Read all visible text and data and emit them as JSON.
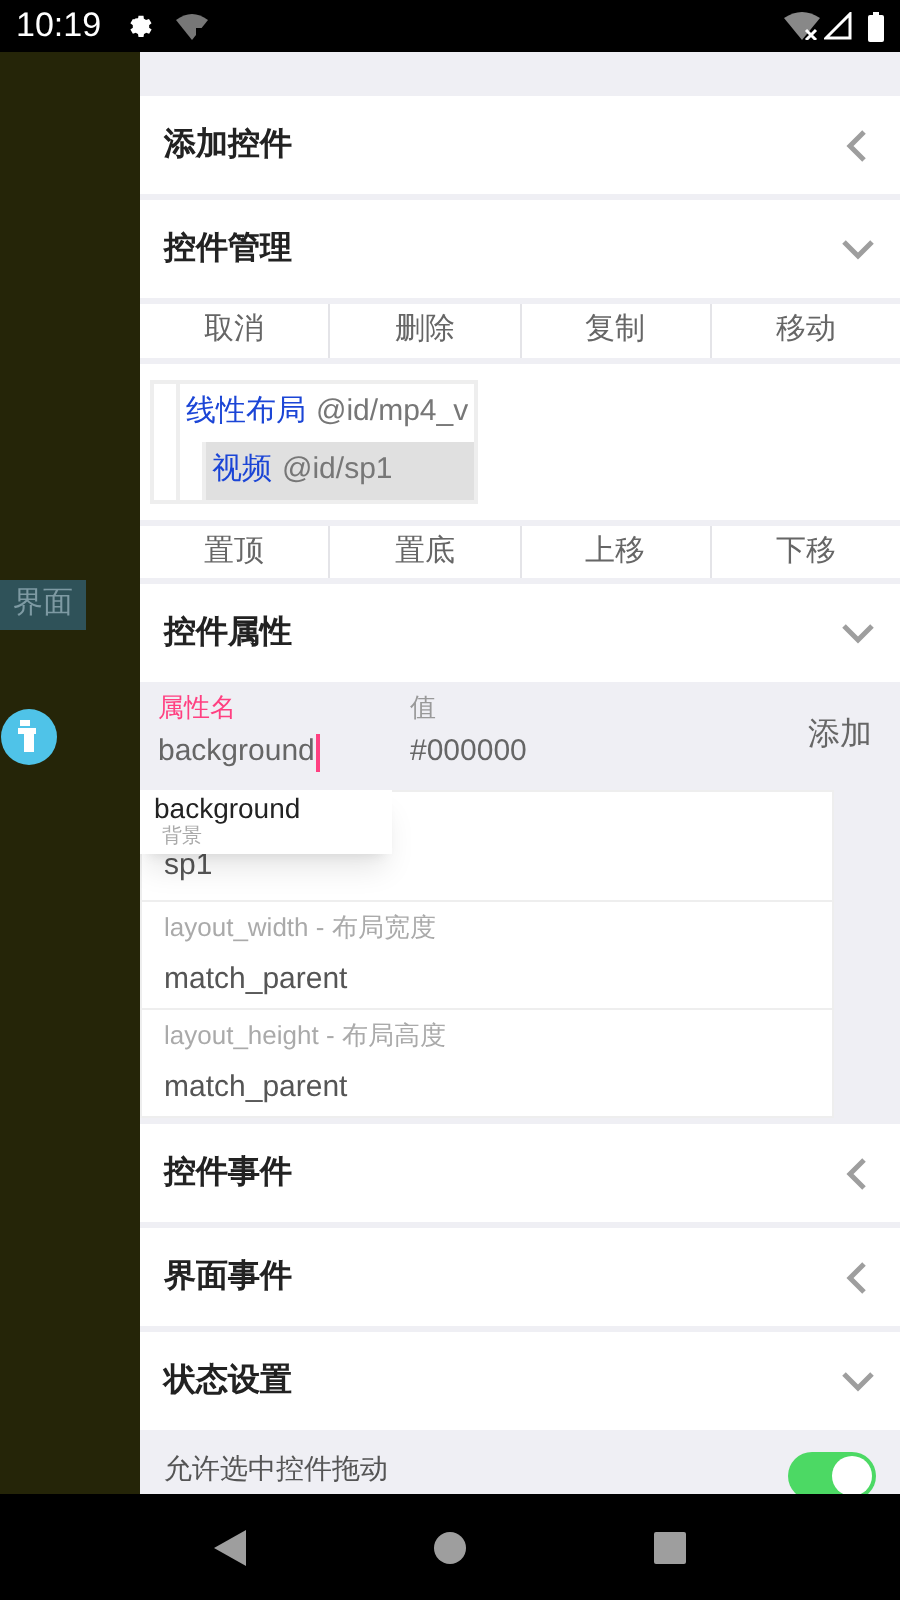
{
  "status_bar": {
    "time": "10:19"
  },
  "side_panel": {
    "tab": "界面"
  },
  "sections": [
    {
      "title": "添加控件",
      "expanded": false
    },
    {
      "title": "控件管理",
      "expanded": true,
      "actions_top": [
        "取消",
        "删除",
        "复制",
        "移动"
      ],
      "tree": [
        {
          "label": "线性布局",
          "id": "@id/mp4_v",
          "selected": false,
          "children": [
            {
              "label": "视频",
              "id": "@id/sp1",
              "selected": true
            }
          ]
        }
      ],
      "actions_bottom": [
        "置顶",
        "置底",
        "上移",
        "下移"
      ]
    },
    {
      "title": "控件属性",
      "expanded": true,
      "fields": [
        {
          "label": "属性名",
          "value": "background",
          "focused": true
        },
        {
          "label": "值",
          "value": "#000000",
          "focused": false
        }
      ],
      "add_button": "添加",
      "suggestion": {
        "name": "background",
        "hint": "背景"
      },
      "properties": [
        {
          "value": "sp1"
        },
        {
          "label": "layout_width - 布局宽度",
          "value": "match_parent"
        },
        {
          "label": "layout_height - 布局高度",
          "value": "match_parent"
        }
      ]
    },
    {
      "title": "控件事件",
      "expanded": false
    },
    {
      "title": "界面事件",
      "expanded": false
    },
    {
      "title": "状态设置",
      "expanded": true,
      "toggles": [
        {
          "label": "允许选中控件拖动",
          "on": true
        }
      ]
    }
  ]
}
